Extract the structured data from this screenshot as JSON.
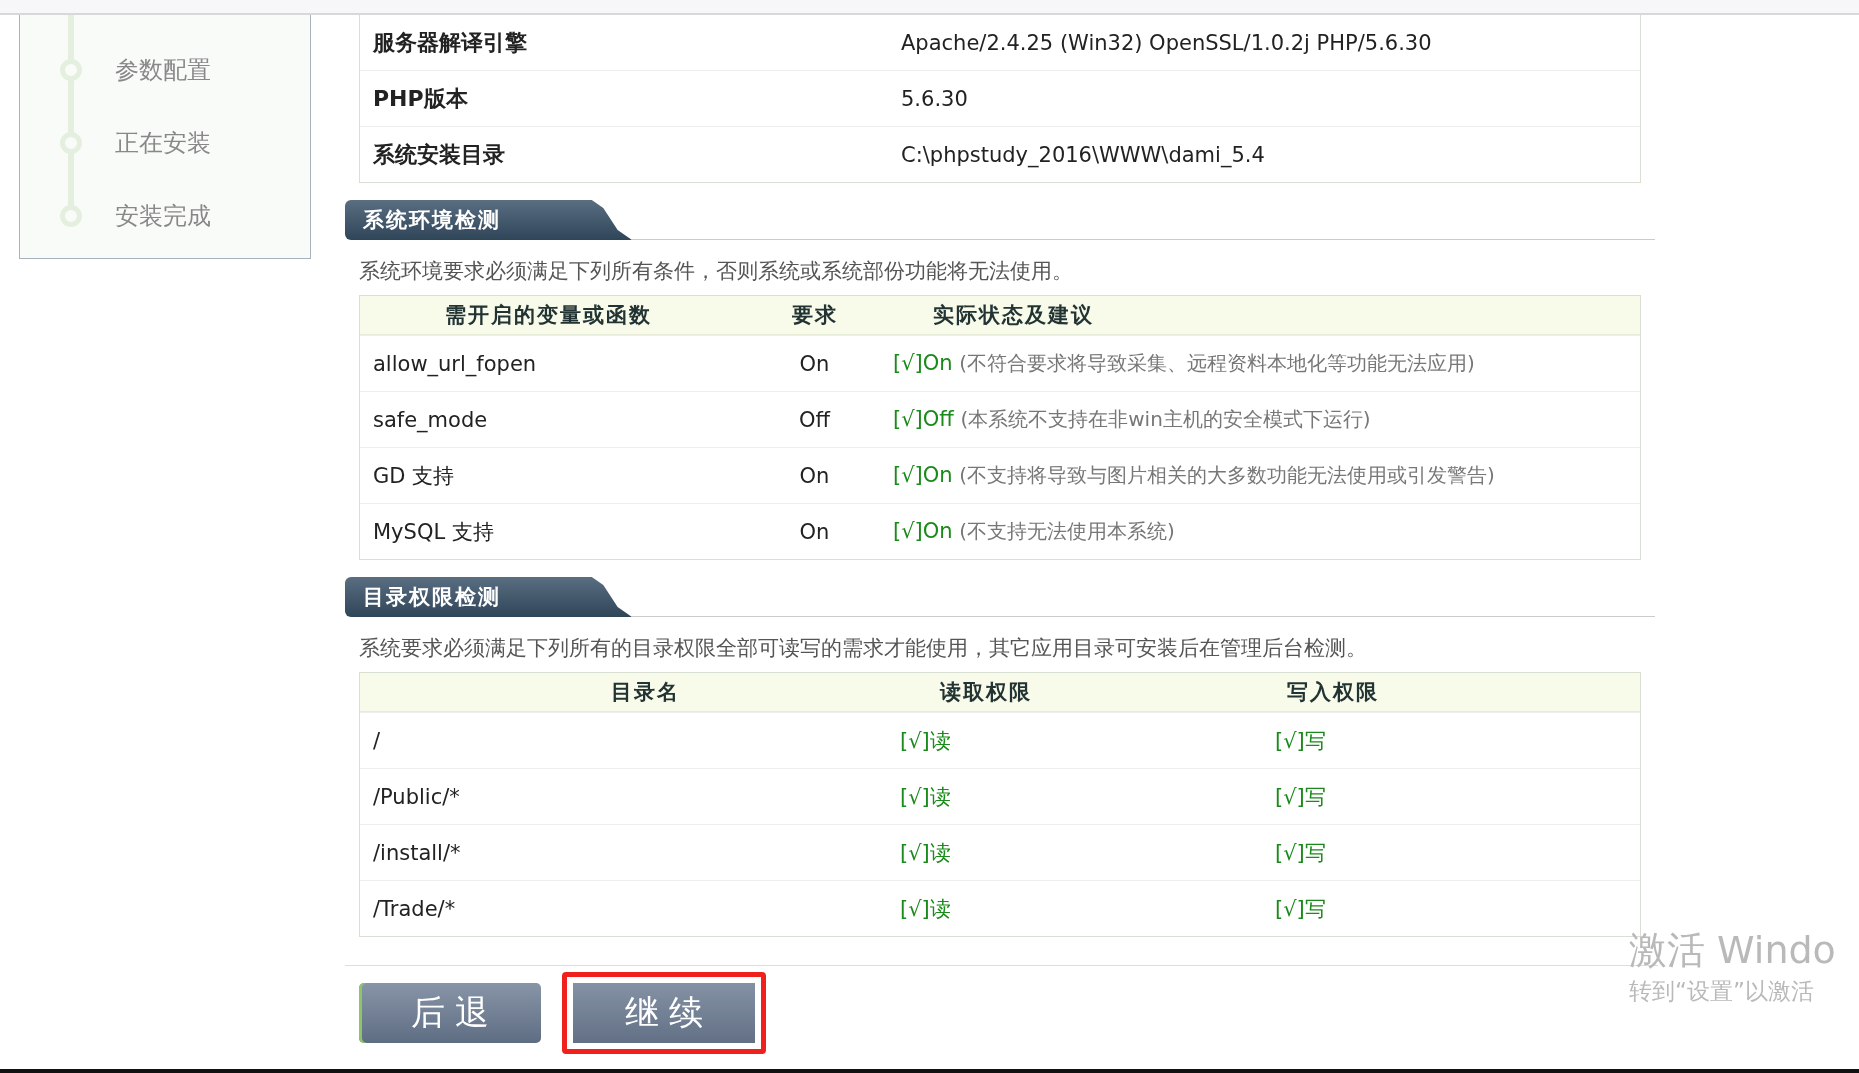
{
  "steps": [
    {
      "label": "参数配置"
    },
    {
      "label": "正在安装"
    },
    {
      "label": "安装完成"
    }
  ],
  "server_info": [
    {
      "label": "服务器解译引擎",
      "value": "Apache/2.4.25 (Win32) OpenSSL/1.0.2j PHP/5.6.30"
    },
    {
      "label": "PHP版本",
      "value": "5.6.30"
    },
    {
      "label": "系统安装目录",
      "value": "C:\\phpstudy_2016\\WWW\\dami_5.4"
    }
  ],
  "env_check": {
    "title": "系统环境检测",
    "description": "系统环境要求必须满足下列所有条件，否则系统或系统部份功能将无法使用。",
    "columns": [
      "需开启的变量或函数",
      "要求",
      "实际状态及建议"
    ],
    "rows": [
      {
        "name": "allow_url_fopen",
        "required": "On",
        "status": "[√]On",
        "ok": true,
        "note": "(不符合要求将导致采集、远程资料本地化等功能无法应用)"
      },
      {
        "name": "safe_mode",
        "required": "Off",
        "status": "[√]Off",
        "ok": true,
        "note": "(本系统不支持在非win主机的安全模式下运行)"
      },
      {
        "name": "GD 支持",
        "required": "On",
        "status": "[√]On",
        "ok": true,
        "note": "(不支持将导致与图片相关的大多数功能无法使用或引发警告)"
      },
      {
        "name": "MySQL 支持",
        "required": "On",
        "status": "[√]On",
        "ok": true,
        "note": "(不支持无法使用本系统)"
      }
    ]
  },
  "dir_check": {
    "title": "目录权限检测",
    "description": "系统要求必须满足下列所有的目录权限全部可读写的需求才能使用，其它应用目录可安装后在管理后台检测。",
    "columns": [
      "目录名",
      "读取权限",
      "写入权限"
    ],
    "rows": [
      {
        "dir": "/",
        "read": "[√]读",
        "read_ok": true,
        "write": "[√]写",
        "write_ok": true
      },
      {
        "dir": "/Public/*",
        "read": "[√]读",
        "read_ok": true,
        "write": "[√]写",
        "write_ok": true
      },
      {
        "dir": "/install/*",
        "read": "[√]读",
        "read_ok": true,
        "write": "[√]写",
        "write_ok": true
      },
      {
        "dir": "/Trade/*",
        "read": "[√]读",
        "read_ok": true,
        "write": "[√]写",
        "write_ok": true
      }
    ]
  },
  "buttons": [
    {
      "label": "后 退",
      "highlighted": false
    },
    {
      "label": "继 续",
      "highlighted": true
    }
  ],
  "activation_notice": {
    "title": "激活 Windo",
    "subtitle": "转到“设置”以激活"
  }
}
